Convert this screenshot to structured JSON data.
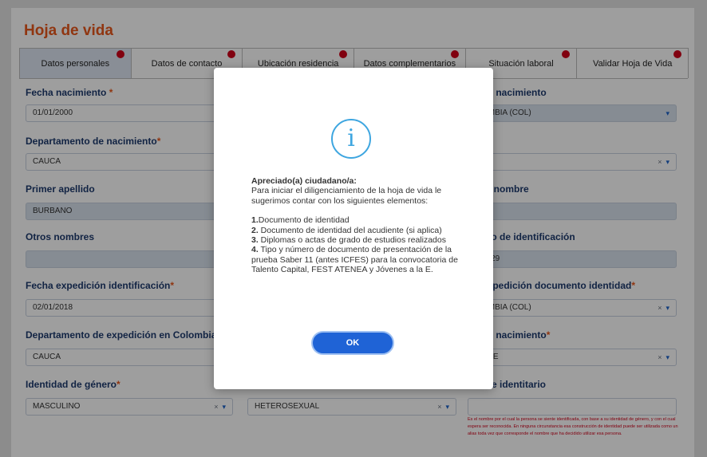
{
  "page_title": "Hoja de vida",
  "tabs": [
    {
      "label": "Datos personales"
    },
    {
      "label": "Datos de contacto"
    },
    {
      "label": "Ubicación residencia"
    },
    {
      "label": "Datos complementarios"
    },
    {
      "label": "Situación laboral"
    },
    {
      "label": "Validar Hoja de Vida"
    }
  ],
  "form": {
    "fecha_nacimiento": {
      "label": "Fecha nacimiento",
      "req": "*",
      "value": "01/01/2000"
    },
    "pais_nacimiento": {
      "label": "de nacimiento",
      "value": "OMBIA (COL)"
    },
    "departamento_nacimiento": {
      "label": "Departamento de nacimiento",
      "req": "*",
      "value": "CAUCA"
    },
    "municipio_nacimiento": {
      "value": ""
    },
    "primer_apellido": {
      "label": "Primer apellido",
      "value": "BURBANO"
    },
    "primer_nombre": {
      "label": "er nombre",
      "value": "AR"
    },
    "otros_nombres": {
      "label": "Otros nombres",
      "value": ""
    },
    "numero_identificacion": {
      "label": "ero de identificación",
      "value": "2729"
    },
    "fecha_expedicion": {
      "label": "Fecha expedición identificación",
      "req": "*",
      "value": "02/01/2018"
    },
    "pais_expedicion": {
      "label": "expedición documento identidad",
      "req": "*",
      "value": "OMBIA (COL)"
    },
    "departamento_expedicion": {
      "label": "Departamento de expedición en Colombia",
      "value": "CAUCA"
    },
    "municipio_nacimiento_2": {
      "label": "de nacimiento",
      "req": "*",
      "value": "BRE"
    },
    "identidad_genero": {
      "label": "Identidad de género",
      "req": "*",
      "value": "MASCULINO"
    },
    "orientacion_sexual": {
      "value": "HETEROSEXUAL"
    },
    "nombre_identitario": {
      "label": "ore identitario",
      "value": ""
    },
    "clear_symbol": "×",
    "caret_symbol": "▾",
    "hint": "Es el nombre por el cual la persona se siente identificada, con base a su identidad de género, y con el cual espera ser reconocida. En ninguna circunstancia esa construcción de identidad puede ser utilizada como un alias toda vez que corresponde el nombre que ha decidido utilizar esa persona."
  },
  "modal": {
    "icon": "i",
    "heading": "Apreciado(a) ciudadano/a:",
    "intro": "Para iniciar el diligenciamiento de la hoja de vida le sugerimos contar con los siguientes elementos:",
    "items": [
      {
        "num": "1.",
        "text": "Documento de identidad"
      },
      {
        "num": "2.",
        "text": " Documento de identidad del acudiente (si aplica)"
      },
      {
        "num": "3.",
        "text": " Diplomas o actas de grado de estudios realizados"
      },
      {
        "num": "4.",
        "text": " Tipo y número de documento de presentación de la prueba Saber 11 (antes ICFES) para la convocatoria de Talento Capital, FEST ATENEA y Jóvenes a la E."
      }
    ],
    "ok_label": "OK"
  },
  "colors": {
    "accent": "#e8571c",
    "label": "#1e3a6e",
    "button": "#1f63d6",
    "info": "#3ea6e0",
    "badge": "#d0021b"
  }
}
